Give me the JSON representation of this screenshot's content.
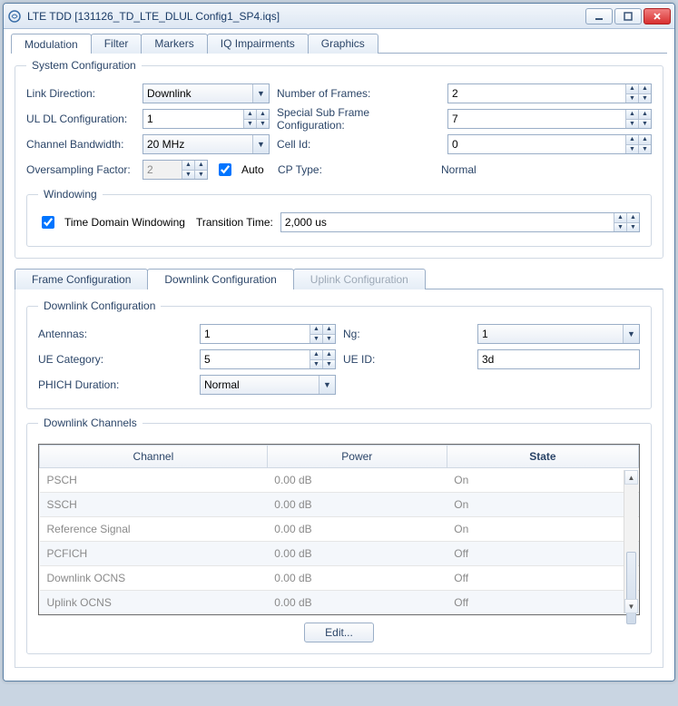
{
  "window": {
    "title": "LTE TDD [131126_TD_LTE_DLUL Config1_SP4.iqs]"
  },
  "main_tabs": [
    "Modulation",
    "Filter",
    "Markers",
    "IQ Impairments",
    "Graphics"
  ],
  "main_tab_active": 0,
  "system_config": {
    "legend": "System Configuration",
    "link_direction_label": "Link Direction:",
    "link_direction_value": "Downlink",
    "number_of_frames_label": "Number of Frames:",
    "number_of_frames_value": "2",
    "uldl_label": "UL DL Configuration:",
    "uldl_value": "1",
    "ssf_label": "Special Sub Frame Configuration:",
    "ssf_value": "7",
    "cbw_label": "Channel Bandwidth:",
    "cbw_value": "20 MHz",
    "cellid_label": "Cell Id:",
    "cellid_value": "0",
    "oversampling_label": "Oversampling Factor:",
    "oversampling_value": "2",
    "auto_label": "Auto",
    "auto_checked": true,
    "cptype_label": "CP Type:",
    "cptype_value": "Normal",
    "windowing": {
      "legend": "Windowing",
      "tdw_label": "Time Domain Windowing",
      "tdw_checked": true,
      "tt_label": "Transition Time:",
      "tt_value": "2,000 us"
    }
  },
  "sub_tabs": [
    "Frame Configuration",
    "Downlink Configuration",
    "Uplink Configuration"
  ],
  "sub_tab_active": 1,
  "downlink_config": {
    "legend": "Downlink Configuration",
    "antennas_label": "Antennas:",
    "antennas_value": "1",
    "ng_label": "Ng:",
    "ng_value": "1",
    "uecat_label": "UE Category:",
    "uecat_value": "5",
    "ueid_label": "UE ID:",
    "ueid_value": "3d",
    "phich_label": "PHICH Duration:",
    "phich_value": "Normal"
  },
  "downlink_channels": {
    "legend": "Downlink Channels",
    "headers": [
      "Channel",
      "Power",
      "State"
    ],
    "rows": [
      {
        "channel": "PSCH",
        "power": "0.00 dB",
        "state": "On"
      },
      {
        "channel": "SSCH",
        "power": "0.00 dB",
        "state": "On"
      },
      {
        "channel": "Reference Signal",
        "power": "0.00 dB",
        "state": "On"
      },
      {
        "channel": "PCFICH",
        "power": "0.00 dB",
        "state": "Off"
      },
      {
        "channel": "Downlink OCNS",
        "power": "0.00 dB",
        "state": "Off"
      },
      {
        "channel": "Uplink OCNS",
        "power": "0.00 dB",
        "state": "Off"
      }
    ],
    "edit_label": "Edit..."
  }
}
